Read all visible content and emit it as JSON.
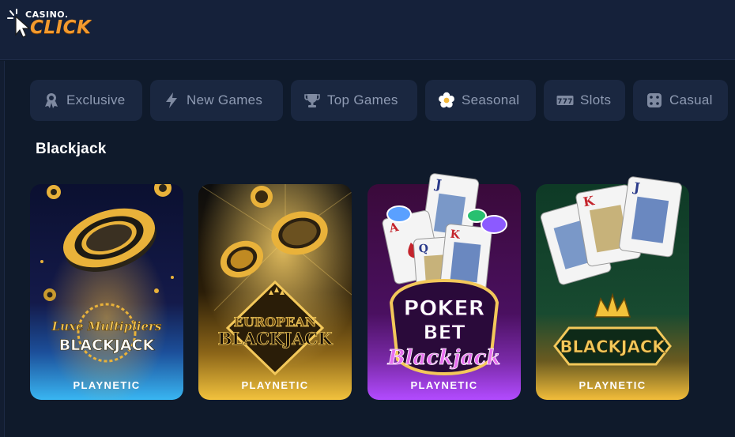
{
  "brand": {
    "small": "CASINO.",
    "big": "CLICK"
  },
  "chips": [
    {
      "label": "Exclusive",
      "icon": "award-ribbon-icon"
    },
    {
      "label": "New Games",
      "icon": "lightning-icon"
    },
    {
      "label": "Top Games",
      "icon": "trophy-icon"
    },
    {
      "label": "Seasonal",
      "icon": "flower-icon"
    },
    {
      "label": "Slots",
      "icon": "slot-777-icon"
    },
    {
      "label": "Casual",
      "icon": "dice-icon"
    }
  ],
  "section": {
    "title": "Blackjack"
  },
  "games": [
    {
      "title_line1": "Luxe Multipliers",
      "title_line2": "BLACKJACK",
      "provider": "PLAYNETIC"
    },
    {
      "title_line1": "EUROPEAN",
      "title_line2": "BLACKJACK",
      "provider": "PLAYNETIC"
    },
    {
      "title_line1": "POKER",
      "title_line2": "BET",
      "title_line3": "Blackjack",
      "provider": "PLAYNETIC"
    },
    {
      "title_line1": "BLACKJACK",
      "provider": "PLAYNETIC"
    }
  ],
  "colors": {
    "page_bg": "#0f1a2b",
    "header_bg": "#15213a",
    "chip_bg": "#1a2740",
    "chip_text": "#8f9bb3",
    "brand_orange": "#f29a2e",
    "gold": "#f3b73a"
  }
}
